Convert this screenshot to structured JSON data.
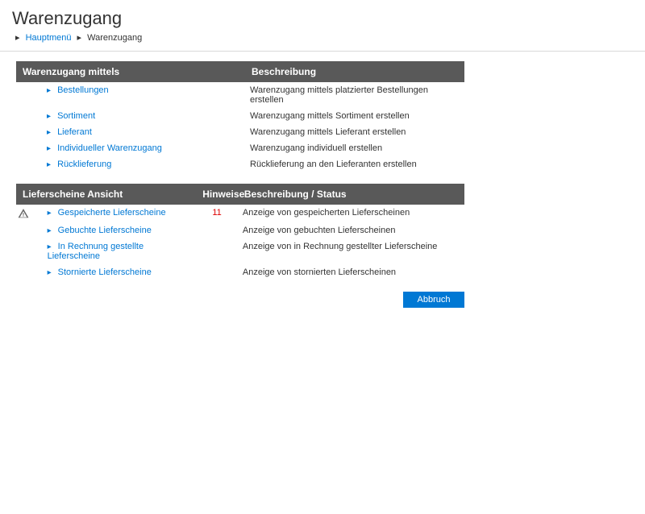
{
  "title": "Warenzugang",
  "breadcrumb": {
    "home": "Hauptmenü",
    "current": "Warenzugang"
  },
  "section1": {
    "header_left": "Warenzugang mittels",
    "header_right": "Beschreibung",
    "rows": [
      {
        "label": "Bestellungen",
        "desc": "Warenzugang mittels platzierter Bestellungen erstellen"
      },
      {
        "label": "Sortiment",
        "desc": "Warenzugang mittels Sortiment erstellen"
      },
      {
        "label": "Lieferant",
        "desc": "Warenzugang mittels Lieferant erstellen"
      },
      {
        "label": "Individueller Warenzugang",
        "desc": "Warenzugang individuell erstellen"
      },
      {
        "label": "Rücklieferung",
        "desc": "Rücklieferung an den Lieferanten erstellen"
      }
    ]
  },
  "section2": {
    "header_left": "Lieferscheine Ansicht",
    "header_mid": "Hinweise",
    "header_right": "Beschreibung / Status",
    "rows": [
      {
        "warn": true,
        "label": "Gespeicherte Lieferscheine",
        "hint": "11",
        "desc": "Anzeige von gespeicherten Lieferscheinen"
      },
      {
        "warn": false,
        "label": "Gebuchte Lieferscheine",
        "hint": "",
        "desc": "Anzeige von gebuchten Lieferscheinen"
      },
      {
        "warn": false,
        "label": "In Rechnung gestellte Lieferscheine",
        "hint": "",
        "desc": "Anzeige von in Rechnung gestellter Lieferscheine"
      },
      {
        "warn": false,
        "label": "Stornierte Lieferscheine",
        "hint": "",
        "desc": "Anzeige von stornierten Lieferscheinen"
      }
    ]
  },
  "buttons": {
    "cancel": "Abbruch"
  }
}
